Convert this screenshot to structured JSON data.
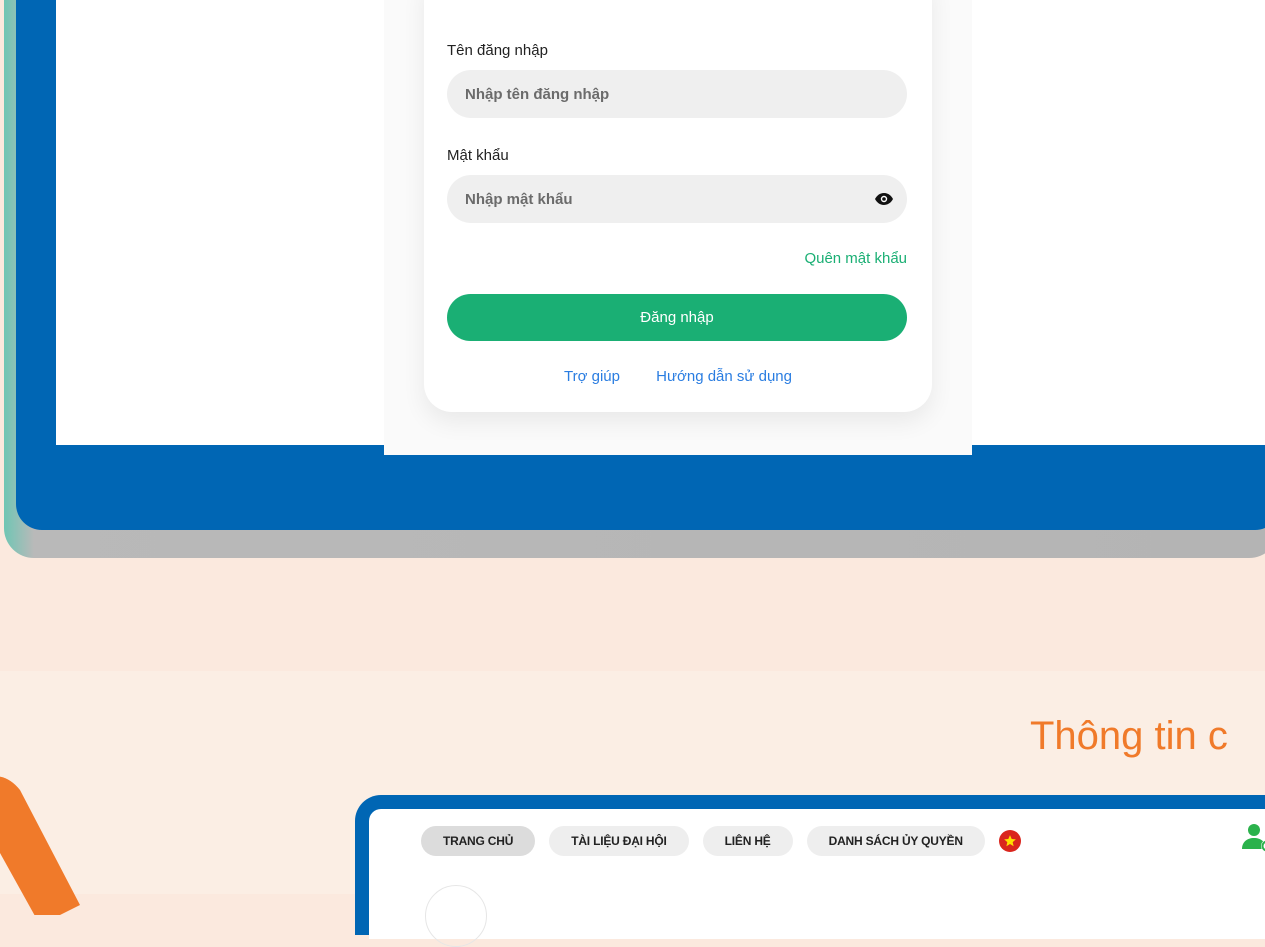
{
  "login": {
    "username_label": "Tên đăng nhập",
    "username_placeholder": "Nhập tên đăng nhập",
    "password_label": "Mật khẩu",
    "password_placeholder": "Nhập mật khẩu",
    "forgot_password": "Quên mật khẩu",
    "login_button": "Đăng nhập",
    "help_link": "Trợ giúp",
    "guide_link": "Hướng dẫn sử dụng"
  },
  "section": {
    "title": "Thông tin c"
  },
  "nav": {
    "items": [
      {
        "label": "TRANG CHỦ"
      },
      {
        "label": "TÀI LIỆU ĐẠI HỘI"
      },
      {
        "label": "LIÊN HỆ"
      },
      {
        "label": "DANH SÁCH ỦY QUYỀN"
      }
    ]
  },
  "colors": {
    "frame_blue": "#0066b4",
    "accent_green": "#1aaf74",
    "link_blue": "#2a7de1",
    "title_orange": "#f07a2a",
    "flag_red": "#da251d"
  },
  "icons": {
    "password_toggle": "eye-icon",
    "language": "vietnam-flag-icon",
    "account": "user-settings-icon"
  }
}
